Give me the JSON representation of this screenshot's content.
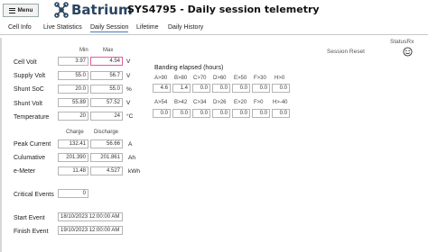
{
  "header": {
    "menu_label": "Menu",
    "logo_text": "Batrium",
    "title": "SYS4795 - Daily session telemetry"
  },
  "tabs": [
    "Cell Info",
    "Live Statistics",
    "Daily Session",
    "Lifetime",
    "Daily History"
  ],
  "active_tab": "Daily Session",
  "status_rx": "StatusRx",
  "session_reset": "Session Reset",
  "min_max": {
    "min_header": "Min",
    "max_header": "Max",
    "rows": [
      {
        "label": "Cell Volt",
        "min": "3.97",
        "max": "4.54",
        "unit": "V"
      },
      {
        "label": "Supply Volt",
        "min": "55.0",
        "max": "56.7",
        "unit": "V"
      },
      {
        "label": "Shunt SoC",
        "min": "20.0",
        "max": "55.0",
        "unit": "%"
      },
      {
        "label": "Shunt Volt",
        "min": "55.89",
        "max": "57.52",
        "unit": "V"
      },
      {
        "label": "Temperature",
        "min": "20",
        "max": "24",
        "unit": "°C"
      }
    ]
  },
  "banding": {
    "title": "Banding elapsed (hours)",
    "row1": [
      {
        "label": "A>90",
        "value": "4.6"
      },
      {
        "label": "B>80",
        "value": "1.4"
      },
      {
        "label": "C>70",
        "value": "0.0"
      },
      {
        "label": "D>60",
        "value": "0.0"
      },
      {
        "label": "E>50",
        "value": "0.0"
      },
      {
        "label": "F>30",
        "value": "0.0"
      },
      {
        "label": "H>0",
        "value": "0.0"
      }
    ],
    "row2": [
      {
        "label": "A>54",
        "value": "0.0"
      },
      {
        "label": "B>42",
        "value": "0.0"
      },
      {
        "label": "C>34",
        "value": "0.0"
      },
      {
        "label": "D>26",
        "value": "0.0"
      },
      {
        "label": "E>20",
        "value": "0.0"
      },
      {
        "label": "F>0",
        "value": "0.0"
      },
      {
        "label": "H>-40",
        "value": "0.0"
      }
    ]
  },
  "charge_discharge": {
    "charge_header": "Charge",
    "discharge_header": "Discharge",
    "rows": [
      {
        "label": "Peak Current",
        "charge": "132.41",
        "discharge": "56.66",
        "unit": "A"
      },
      {
        "label": "Culumative",
        "charge": "201.390",
        "discharge": "201.861",
        "unit": "Ah"
      },
      {
        "label": "e-Meter",
        "charge": "11.48",
        "discharge": "4.527",
        "unit": "kWh"
      }
    ]
  },
  "critical_events": {
    "label": "Critical Events",
    "value": "0"
  },
  "start_event": {
    "label": "Start Event",
    "value": "18/10/2023 12:00:00 AM"
  },
  "finish_event": {
    "label": "Finish Event",
    "value": "19/10/2023 12:00:00 AM"
  }
}
